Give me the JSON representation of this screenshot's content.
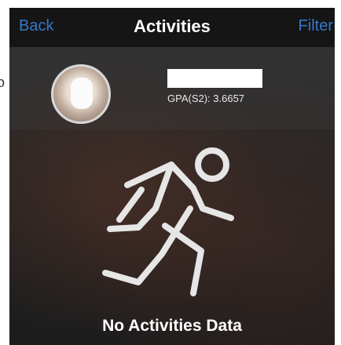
{
  "navbar": {
    "back_label": "Back",
    "title": "Activities",
    "filter_label": "Filter"
  },
  "profile": {
    "gpa_text": "GPA(S2): 3.6657"
  },
  "empty_state": {
    "icon": "running-person-icon",
    "message": "No Activities Data"
  },
  "edge_glyph": "o",
  "colors": {
    "accent": "#3478c7",
    "navbar_bg": "#141414",
    "text": "#ffffff"
  }
}
